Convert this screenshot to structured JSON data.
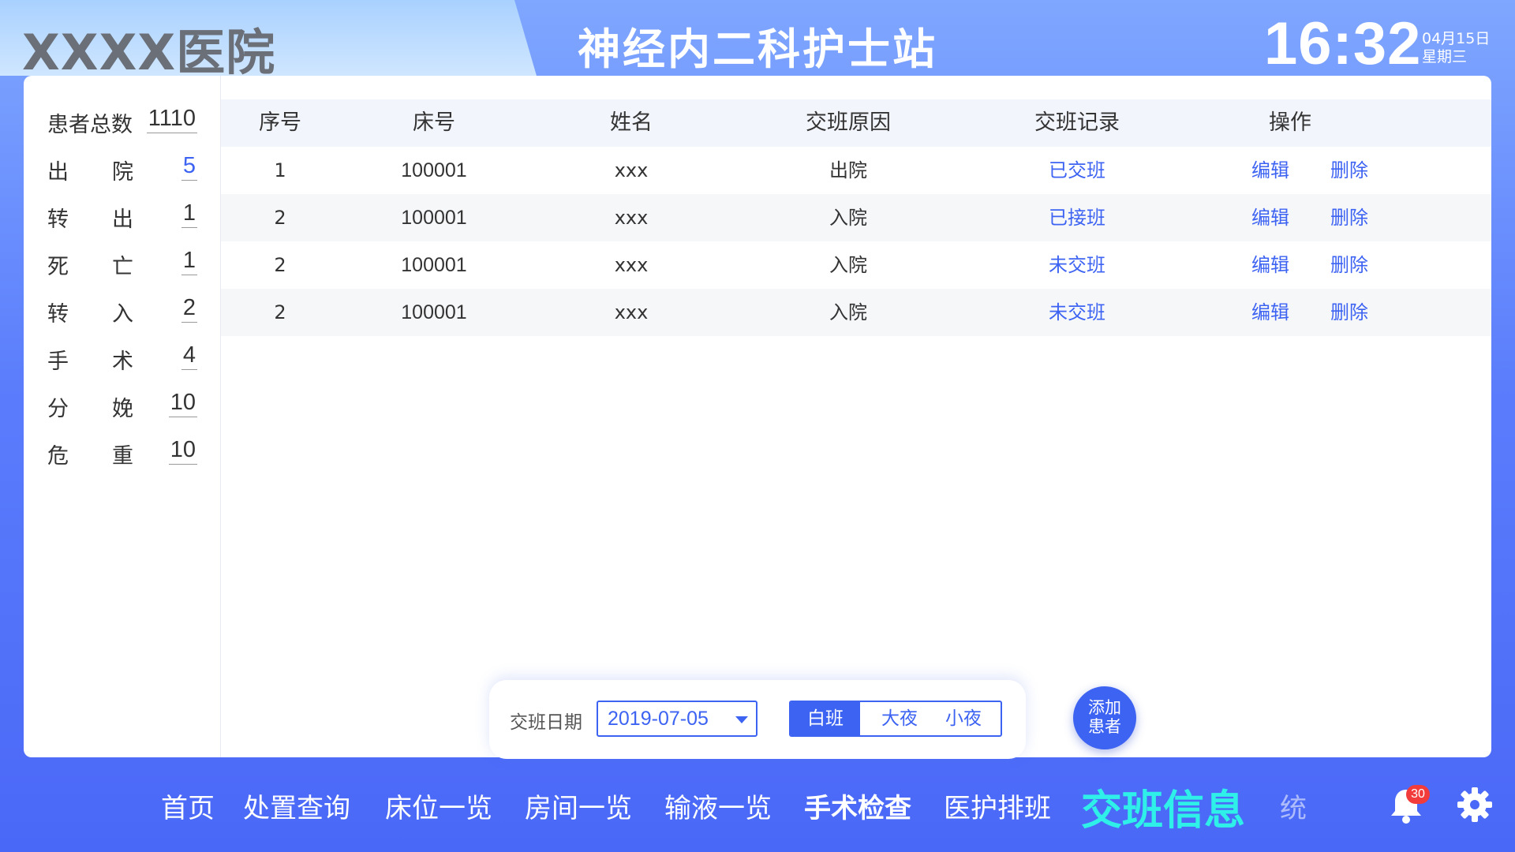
{
  "header": {
    "hospital_name": "XXXX医院",
    "station_title": "神经内二科护士站",
    "time": "16:32",
    "date": "04月15日",
    "weekday": "星期三"
  },
  "stats": {
    "total_label": "患者总数",
    "total_value": "1110",
    "items": [
      {
        "c1": "出",
        "c2": "院",
        "value": "5",
        "color": "#3d63f2"
      },
      {
        "c1": "转",
        "c2": "出",
        "value": "1"
      },
      {
        "c1": "死",
        "c2": "亡",
        "value": "1"
      },
      {
        "c1": "转",
        "c2": "入",
        "value": "2"
      },
      {
        "c1": "手",
        "c2": "术",
        "value": "4"
      },
      {
        "c1": "分",
        "c2": "娩",
        "value": "10"
      },
      {
        "c1": "危",
        "c2": "重",
        "value": "10"
      }
    ]
  },
  "table": {
    "headers": [
      "序号",
      "床号",
      "姓名",
      "交班原因",
      "交班记录",
      "操作"
    ],
    "rows": [
      {
        "seq": "1",
        "bed": "100001",
        "name": "xxx",
        "reason": "出院",
        "record": "已交班",
        "edit": "编辑",
        "delete": "删除"
      },
      {
        "seq": "2",
        "bed": "100001",
        "name": "xxx",
        "reason": "入院",
        "record": "已接班",
        "edit": "编辑",
        "delete": "删除"
      },
      {
        "seq": "2",
        "bed": "100001",
        "name": "xxx",
        "reason": "入院",
        "record": "未交班",
        "edit": "编辑",
        "delete": "删除"
      },
      {
        "seq": "2",
        "bed": "100001",
        "name": "xxx",
        "reason": "入院",
        "record": "未交班",
        "edit": "编辑",
        "delete": "删除"
      }
    ]
  },
  "filter": {
    "date_label": "交班日期",
    "date_value": "2019-07-05",
    "shifts": [
      "白班",
      "大夜",
      "小夜"
    ],
    "active_shift": "白班"
  },
  "add_button": {
    "line1": "添加",
    "line2": "患者"
  },
  "nav": {
    "items": [
      "首页",
      "处置查询",
      "床位一览",
      "房间一览",
      "输液一览",
      "手术检查",
      "医护排班",
      "交班信息",
      "统"
    ],
    "active": "交班信息"
  },
  "notifications": {
    "count": "30"
  },
  "colors": {
    "accent": "#3d63f2",
    "active_nav": "#2ff0e8",
    "badge": "#f23b3b"
  }
}
